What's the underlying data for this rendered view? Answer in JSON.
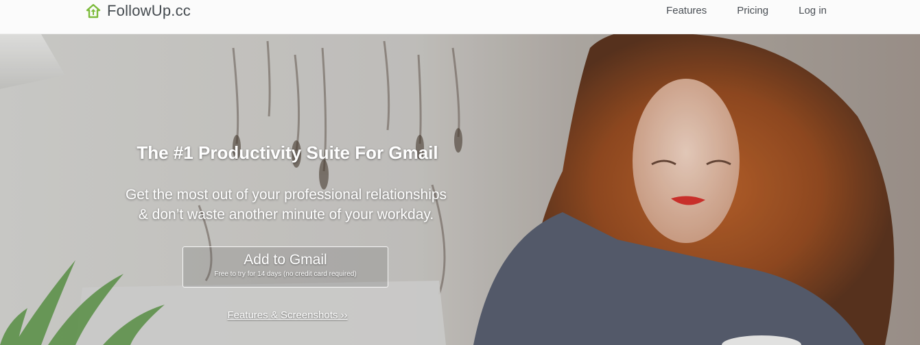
{
  "navbar": {
    "brand_name": "FollowUp.cc",
    "brand_icon": "house-arrow-up-icon",
    "brand_color": "#7dbb3c",
    "links": [
      {
        "label": "Features"
      },
      {
        "label": "Pricing"
      },
      {
        "label": "Log in"
      }
    ]
  },
  "hero": {
    "title": "The #1 Productivity Suite For Gmail",
    "subtitle_line1": "Get the most out of your professional relationships",
    "subtitle_line2": "& don’t waste another minute of your workday.",
    "cta_label": "Add to Gmail",
    "cta_note": "Free to try for 14 days (no credit card required)",
    "secondary_link": "Features & Screenshots ››"
  }
}
